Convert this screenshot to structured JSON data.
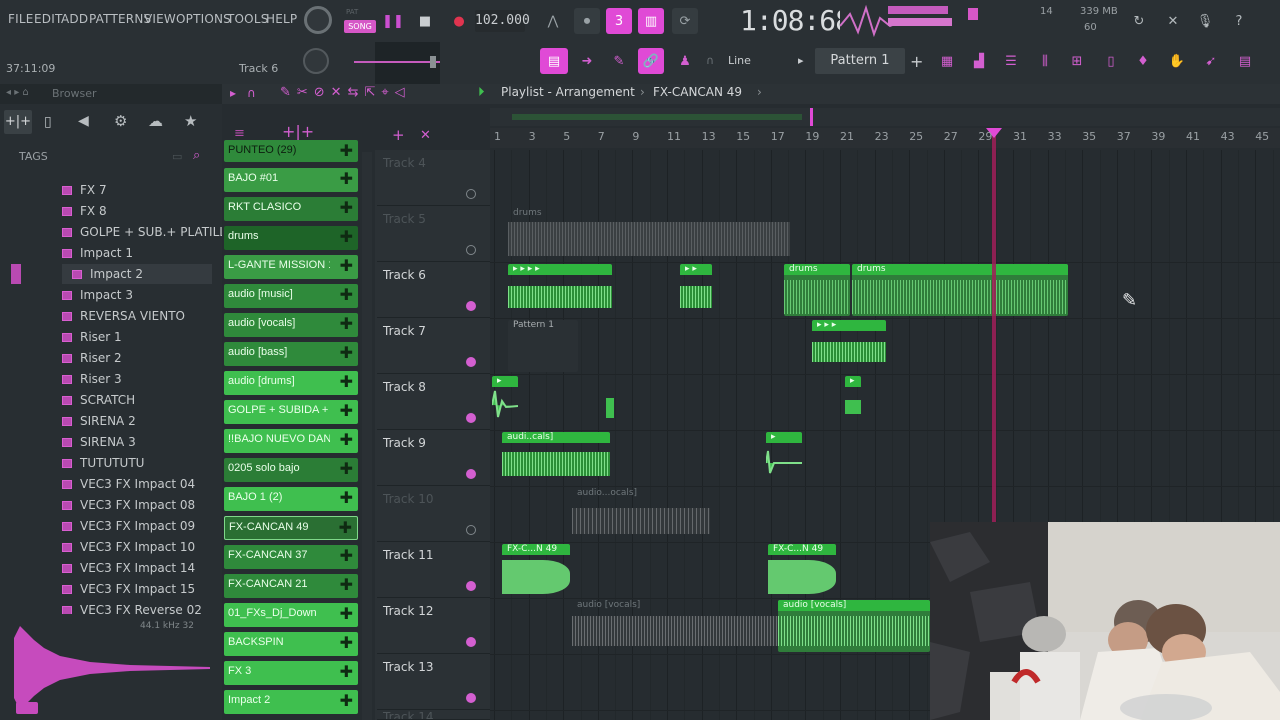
{
  "menu": [
    "FILE",
    "EDIT",
    "ADD",
    "PATTERNS",
    "VIEW",
    "OPTIONS",
    "TOOLS",
    "HELP"
  ],
  "transport": {
    "pat_label": "PAT",
    "song_label": "SONG",
    "tempo": "102.000",
    "time": "1:08:68",
    "cpu_top": "14",
    "mem": "339 MB",
    "cpu_bottom": "60",
    "hint_time": "37:11:09",
    "hint_track": "Track 6"
  },
  "toolbar2": {
    "snap_label": "Line",
    "pattern_label": "Pattern 1"
  },
  "browser": {
    "title": "Browser",
    "tags_label": "TAGS",
    "items": [
      "FX 7",
      "FX 8",
      "GOLPE + SUB.+ PLATILLO",
      "Impact 1",
      "Impact 2",
      "Impact 3",
      "REVERSA VIENTO",
      "Riser 1",
      "Riser 2",
      "Riser 3",
      "SCRATCH",
      "SIRENA 2",
      "SIRENA 3",
      "TUTUTUTU",
      "VEC3 FX Impact 04",
      "VEC3 FX Impact 08",
      "VEC3 FX Impact 09",
      "VEC3 FX Impact 10",
      "VEC3 FX Impact 14",
      "VEC3 FX Impact 15",
      "VEC3 FX Reverse 02"
    ],
    "selected": "Impact 2",
    "sample_rate": "44.1 kHz 32"
  },
  "channels": [
    "PUNTEO (29)",
    "BAJO #01",
    "RKT CLASICO",
    "drums",
    "L-GANTE MISSION 19...",
    "audio [music]",
    "audio [vocals]",
    "audio [bass]",
    "audio [drums]",
    "GOLPE + SUBIDA + PL...",
    "!!BAJO NUEVO DAN DA...",
    "0205 solo bajo",
    "BAJO 1 (2)",
    "FX-CANCAN 49",
    "FX-CANCAN 37",
    "FX-CANCAN 21",
    "01_FXs_Dj_Down",
    "BACKSPIN",
    "FX 3",
    "Impact 2"
  ],
  "playlist": {
    "title": "Playlist - Arrangement",
    "sep": "›",
    "current": "FX-CANCAN 49",
    "bars": [
      "1",
      "3",
      "5",
      "7",
      "9",
      "11",
      "13",
      "15",
      "17",
      "19",
      "21",
      "23",
      "25",
      "27",
      "29",
      "31",
      "33",
      "35",
      "37",
      "39",
      "41",
      "43",
      "45"
    ],
    "tracks": [
      "Track 4",
      "Track 5",
      "Track 6",
      "Track 7",
      "Track 8",
      "Track 9",
      "Track 10",
      "Track 11",
      "Track 12",
      "Track 13",
      "Track 14"
    ],
    "clips": {
      "drums_gray": "drums",
      "drums_a": "drums",
      "drums_b": "drums",
      "pattern1": "Pattern 1",
      "audi_cals": "audi..cals]",
      "audio_ocals": "audio...ocals]",
      "fx_c_n_49_a": "FX-C...N 49",
      "fx_c_n_49_b": "FX-C...N 49",
      "audio_vocals_gray": "audio [vocals]",
      "audio_vocals": "audio [vocals]"
    }
  },
  "colors": {
    "accent": "#e04ad6",
    "clip_green": "#3fbf4f",
    "playhead": "#a01f58"
  }
}
